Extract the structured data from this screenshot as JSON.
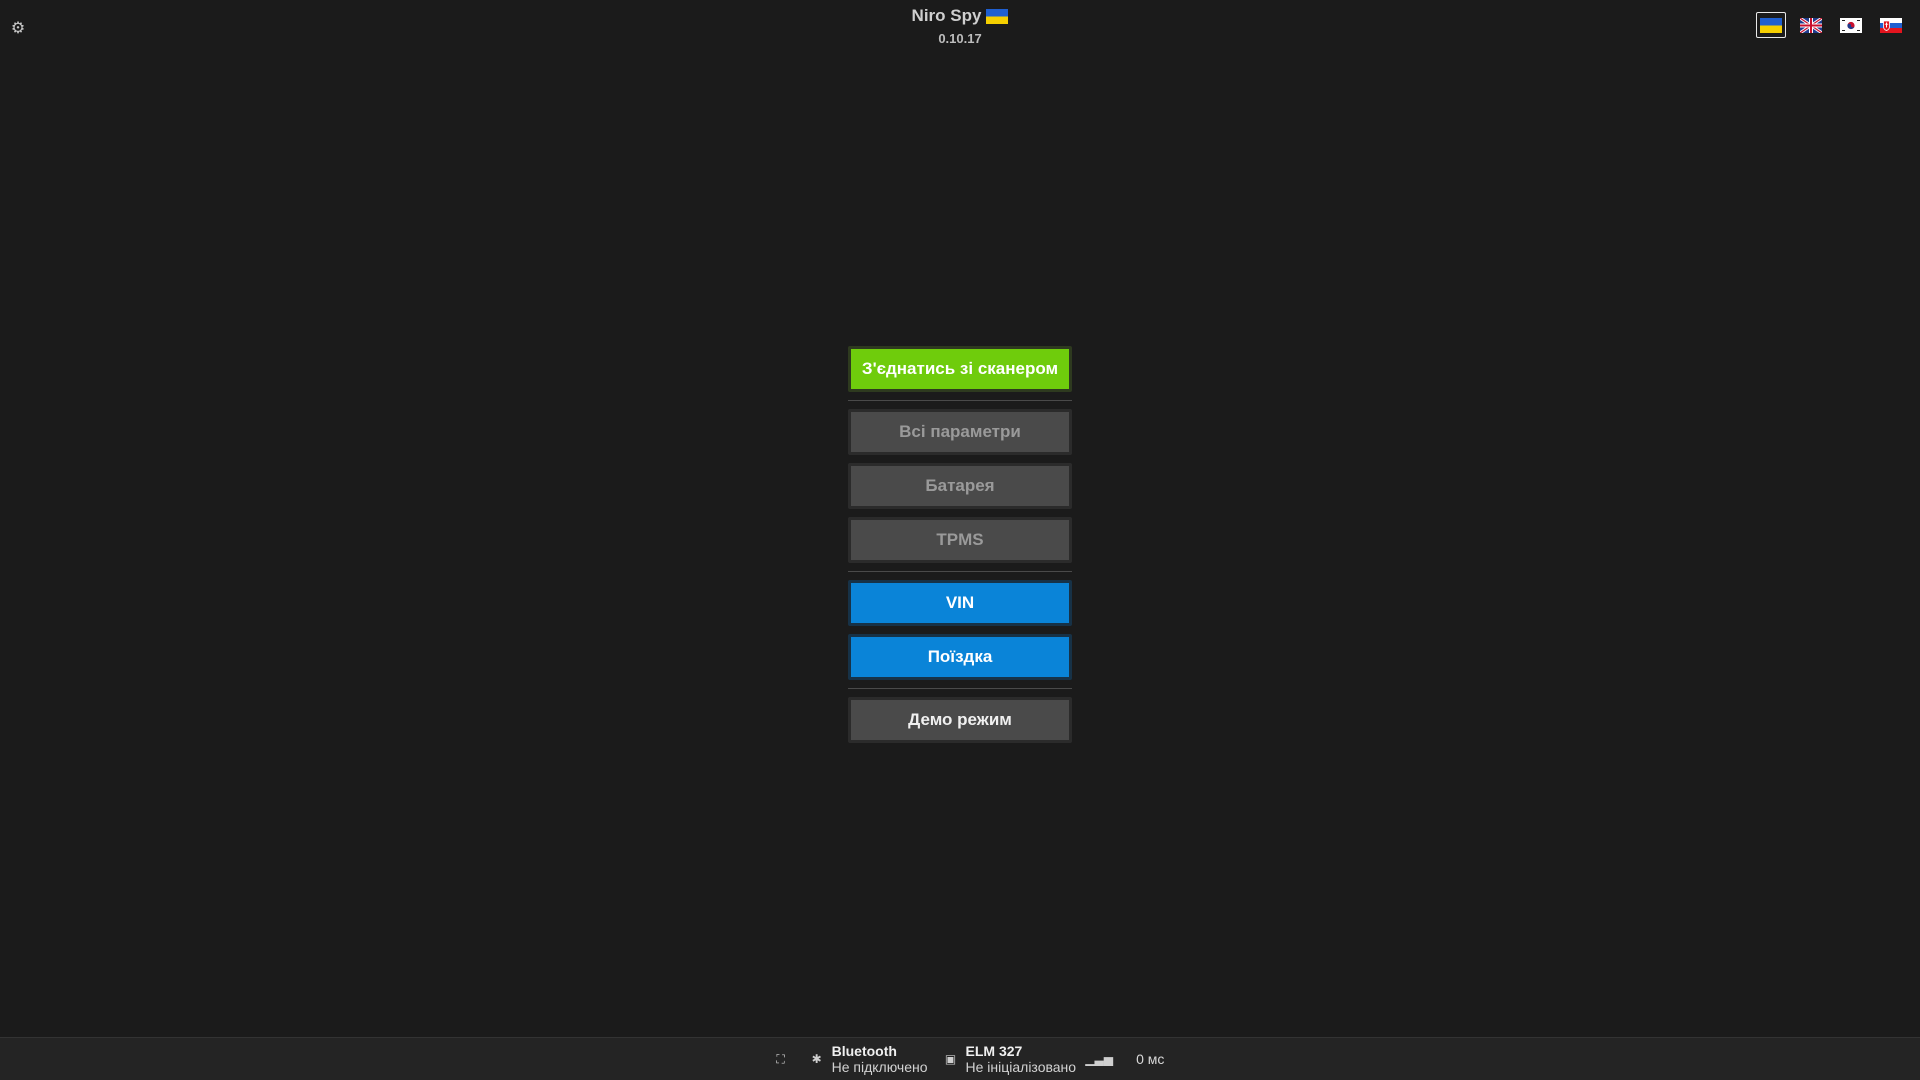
{
  "header": {
    "app_title": "Niro Spy",
    "version": "0.10.17",
    "settings_icon": "gear-icon"
  },
  "languages": [
    {
      "code": "uk",
      "flag": "ukraine-flag-icon",
      "active": true
    },
    {
      "code": "en",
      "flag": "uk-flag-icon",
      "active": false
    },
    {
      "code": "ko",
      "flag": "korea-flag-icon",
      "active": false
    },
    {
      "code": "sk",
      "flag": "slovakia-flag-icon",
      "active": false
    }
  ],
  "menu": {
    "connect": "З'єднатись зі сканером",
    "all_params": "Всі параметри",
    "battery": "Батарея",
    "tpms": "TPMS",
    "vin": "VIN",
    "trip": "Поїздка",
    "demo": "Демо режим"
  },
  "status": {
    "bluetooth_label": "Bluetooth",
    "bluetooth_state": "Не підключено",
    "elm_label": "ELM 327",
    "elm_state": "Не ініціалізовано",
    "latency": "0 мс"
  },
  "colors": {
    "background": "#1b1b1b",
    "connect_green": "#6fcc0c",
    "action_blue": "#0a84d8",
    "disabled_grey": "#4a4a4a"
  }
}
